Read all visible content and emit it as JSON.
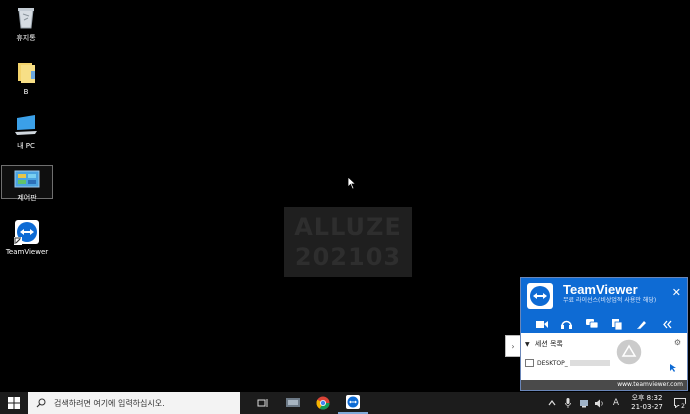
{
  "desktop": {
    "icons": [
      {
        "label": "휴지통",
        "icon": "recycle-bin-icon"
      },
      {
        "label": "B",
        "icon": "folder-icon"
      },
      {
        "label": "내 PC",
        "icon": "computer-icon"
      },
      {
        "label": "제어판",
        "icon": "control-panel-icon"
      },
      {
        "label": "TeamViewer",
        "icon": "teamviewer-icon"
      }
    ]
  },
  "watermark": {
    "line1": "ALLUZE",
    "line2": "202103"
  },
  "teamviewer": {
    "title": "TeamViewer",
    "subtitle": "무료 라이선스(비상업적 사용만 해당)",
    "close": "✕",
    "section_label": "세션 목록",
    "session_name": "DESKTOP_",
    "footer_link": "www.teamviewer.com",
    "accent": "#0e6bd4"
  },
  "taskbar": {
    "search_placeholder": "검색하려면 여기에 입력하십시오.",
    "ime": "A",
    "time_ampm": "오후 8:32",
    "date": "21-03-27",
    "notification_count": "2"
  }
}
